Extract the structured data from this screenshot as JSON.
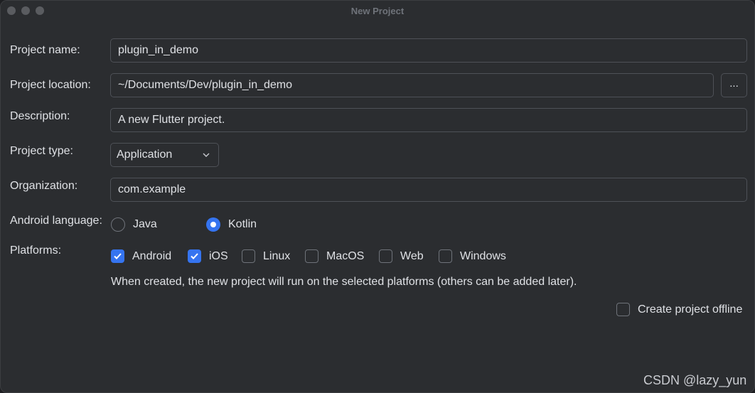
{
  "window": {
    "title": "New Project"
  },
  "form": {
    "project_name": {
      "label": "Project name:",
      "value": "plugin_in_demo"
    },
    "project_location": {
      "label": "Project location:",
      "value": "~/Documents/Dev/plugin_in_demo",
      "browse_label": "..."
    },
    "description": {
      "label": "Description:",
      "value": "A new Flutter project."
    },
    "project_type": {
      "label": "Project type:",
      "value": "Application"
    },
    "organization": {
      "label": "Organization:",
      "value": "com.example"
    },
    "android_language": {
      "label": "Android language:",
      "options": [
        {
          "label": "Java",
          "selected": false
        },
        {
          "label": "Kotlin",
          "selected": true
        }
      ]
    },
    "platforms": {
      "label": "Platforms:",
      "options": [
        {
          "label": "Android",
          "checked": true
        },
        {
          "label": "iOS",
          "checked": true
        },
        {
          "label": "Linux",
          "checked": false
        },
        {
          "label": "MacOS",
          "checked": false
        },
        {
          "label": "Web",
          "checked": false
        },
        {
          "label": "Windows",
          "checked": false
        }
      ],
      "hint": "When created, the new project will run on the selected platforms (others can be added later)."
    },
    "offline": {
      "label": "Create project offline",
      "checked": false
    }
  },
  "watermark": "CSDN @lazy_yun",
  "colors": {
    "accent": "#3574f0",
    "background": "#2b2d30",
    "border": "#4e5157"
  }
}
